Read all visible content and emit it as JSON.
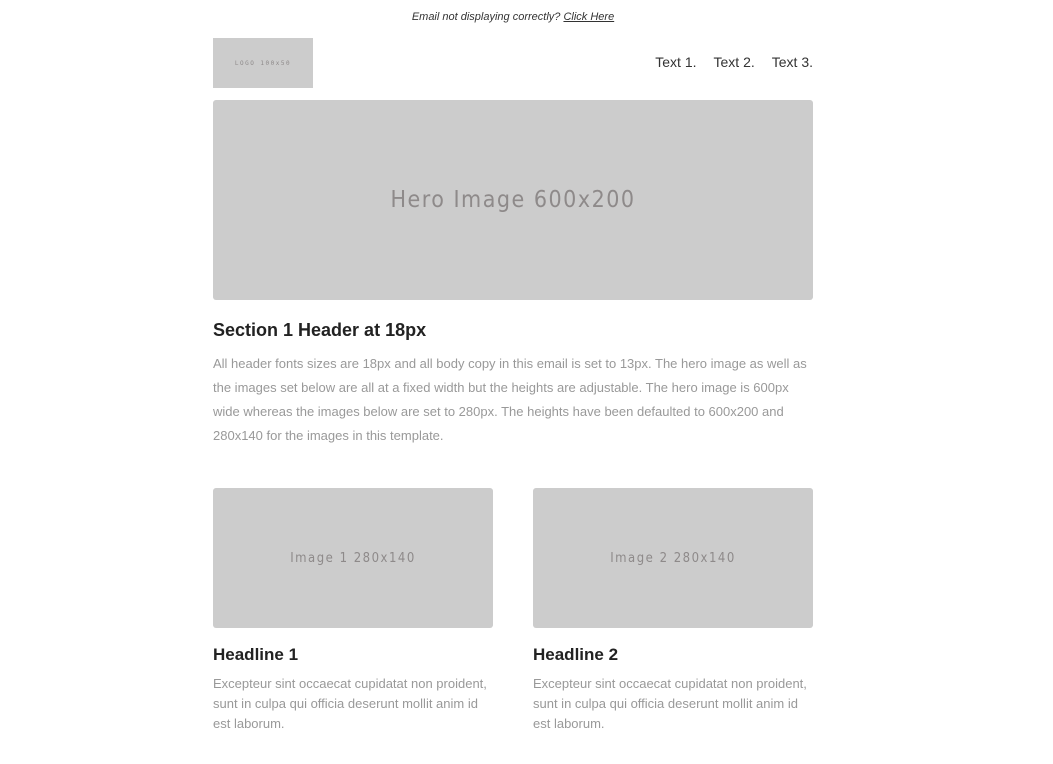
{
  "preheader": {
    "text": "Email not displaying correctly?",
    "link": "Click Here"
  },
  "header": {
    "logo_text": "LOGO 100x50",
    "nav": [
      "Text 1.",
      "Text 2.",
      "Text 3."
    ]
  },
  "hero": {
    "label": "Hero Image 600x200"
  },
  "section1": {
    "title": "Section 1 Header at 18px",
    "body": "All header fonts sizes are 18px and all body copy in this email is set to 13px. The hero image as well as the images set below are all at a fixed width but the heights are adjustable. The hero image is 600px wide whereas the images below are set to 280px. The heights have been defaulted to 600x200 and 280x140 for the images in this template."
  },
  "columns": [
    {
      "image_label": "Image 1 280x140",
      "headline": "Headline 1",
      "body": "Excepteur sint occaecat cupidatat non proident, sunt in culpa qui officia deserunt mollit anim id est laborum."
    },
    {
      "image_label": "Image 2 280x140",
      "headline": "Headline 2",
      "body": "Excepteur sint occaecat cupidatat non proident, sunt in culpa qui officia deserunt mollit anim id est laborum."
    }
  ],
  "colors": {
    "placeholder_bg": "#cccccc",
    "placeholder_text": "#8e8a8a",
    "heading": "#222222",
    "body_text": "#999999"
  }
}
